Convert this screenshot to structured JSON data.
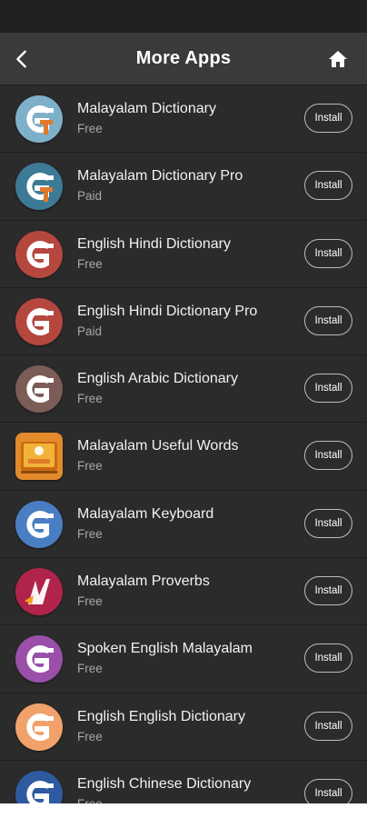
{
  "header": {
    "title": "More Apps"
  },
  "icons": {
    "back": "chevron-left-icon",
    "home": "home-icon"
  },
  "apps": [
    {
      "name": "Malayalam Dictionary",
      "price": "Free",
      "install_label": "Install",
      "icon_bg": "#7fb0c9",
      "icon_accent": "#e07a2a",
      "icon_style": "ct"
    },
    {
      "name": "Malayalam Dictionary Pro",
      "price": "Paid",
      "install_label": "Install",
      "icon_bg": "#3d7a96",
      "icon_accent": "#e07a2a",
      "icon_style": "ct"
    },
    {
      "name": "English Hindi Dictionary",
      "price": "Free",
      "install_label": "Install",
      "icon_bg": "#b5473f",
      "icon_style": "g"
    },
    {
      "name": "English Hindi Dictionary Pro",
      "price": "Paid",
      "install_label": "Install",
      "icon_bg": "#b5473f",
      "icon_style": "g"
    },
    {
      "name": "English Arabic Dictionary",
      "price": "Free",
      "install_label": "Install",
      "icon_bg": "#7b5c56",
      "icon_style": "g"
    },
    {
      "name": "Malayalam Useful Words",
      "price": "Free",
      "install_label": "Install",
      "icon_bg": "#e38a2a",
      "icon_style": "book"
    },
    {
      "name": "Malayalam Keyboard",
      "price": "Free",
      "install_label": "Install",
      "icon_bg": "#4a7ec4",
      "icon_style": "g"
    },
    {
      "name": "Malayalam Proverbs",
      "price": "Free",
      "install_label": "Install",
      "icon_bg": "#b0234a",
      "icon_style": "proverb"
    },
    {
      "name": "Spoken English Malayalam",
      "price": "Free",
      "install_label": "Install",
      "icon_bg": "#9a4fa8",
      "icon_style": "g"
    },
    {
      "name": "English English Dictionary",
      "price": "Free",
      "install_label": "Install",
      "icon_bg": "#f0a26a",
      "icon_style": "g"
    },
    {
      "name": "English Chinese Dictionary",
      "price": "Free",
      "install_label": "Install",
      "icon_bg": "#2e5aa0",
      "icon_style": "g"
    }
  ]
}
